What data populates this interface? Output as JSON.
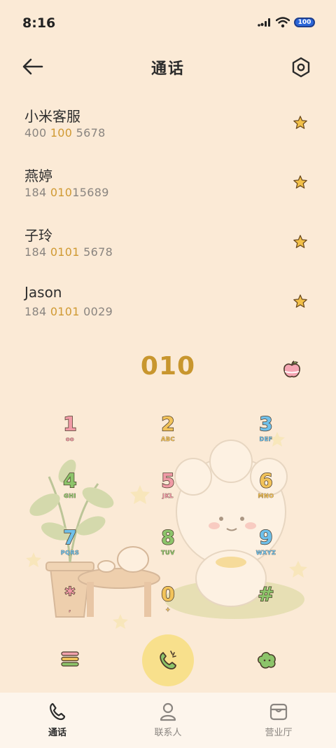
{
  "status": {
    "time": "8:16",
    "battery": "100"
  },
  "header": {
    "title": "通话"
  },
  "contacts": [
    {
      "name": "小米客服",
      "num_parts": [
        "400 ",
        "100",
        " 5678"
      ]
    },
    {
      "name": "燕婷",
      "num_parts": [
        "184 ",
        "010",
        "15689"
      ]
    },
    {
      "name": "子玲",
      "num_parts": [
        "184 ",
        "0101",
        " 5678"
      ]
    },
    {
      "name": "Jason",
      "num_parts": [
        "184 ",
        "0101",
        " 0029"
      ]
    }
  ],
  "dialpad": {
    "input": "010",
    "keys": [
      {
        "digit": "1",
        "letters": "oo"
      },
      {
        "digit": "2",
        "letters": "ABC"
      },
      {
        "digit": "3",
        "letters": "DEF"
      },
      {
        "digit": "4",
        "letters": "GHI"
      },
      {
        "digit": "5",
        "letters": "JKL"
      },
      {
        "digit": "6",
        "letters": "MNO"
      },
      {
        "digit": "7",
        "letters": "PQRS"
      },
      {
        "digit": "8",
        "letters": "TUV"
      },
      {
        "digit": "9",
        "letters": "WXYZ"
      },
      {
        "digit": "*",
        "letters": ","
      },
      {
        "digit": "0",
        "letters": "+"
      },
      {
        "digit": "#",
        "letters": ""
      }
    ]
  },
  "bottom_nav": {
    "calls": "通话",
    "contacts": "联系人",
    "store": "营业厅"
  },
  "colors": {
    "accent": "#c8962e",
    "background": "#fbead6",
    "call_button": "#f8e08c"
  }
}
